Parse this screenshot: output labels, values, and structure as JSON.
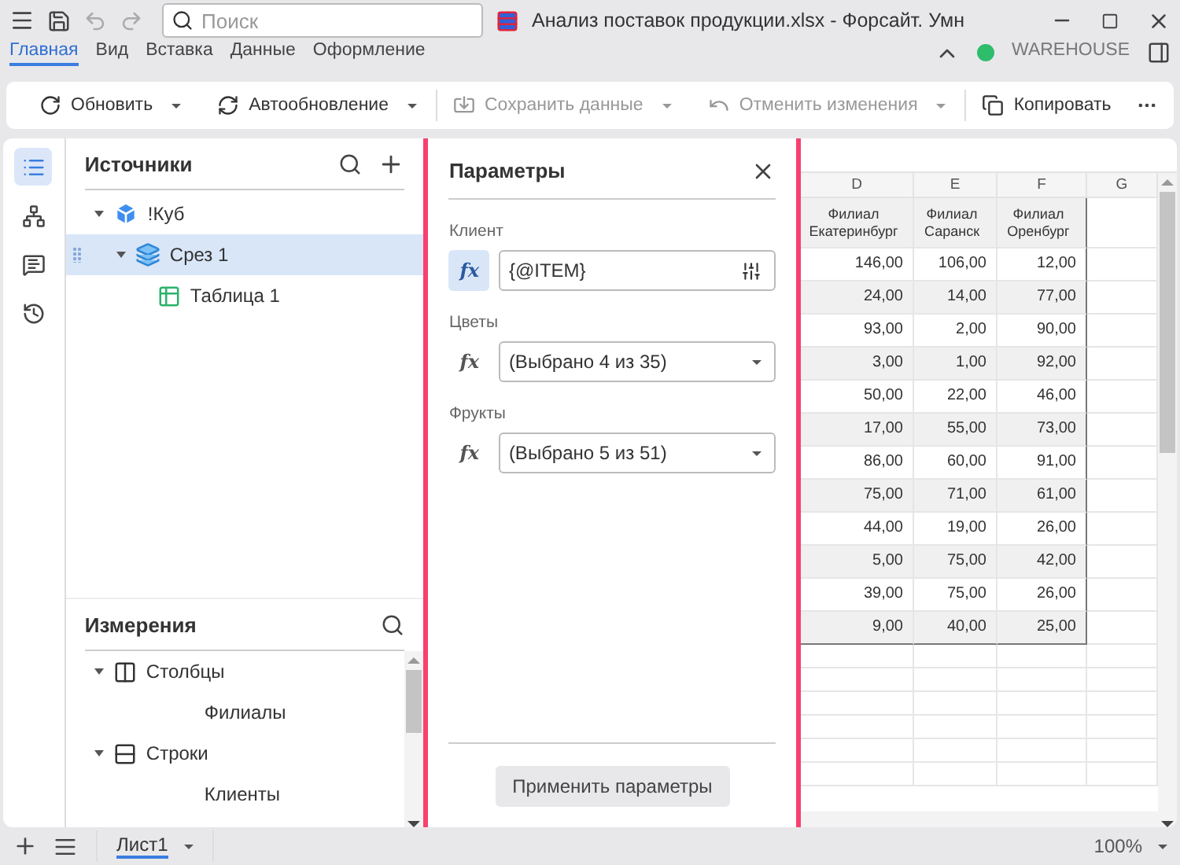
{
  "window": {
    "title": "Анализ поставок продукции.xlsx - Форсайт. Умн",
    "search": {
      "placeholder": "Поиск"
    }
  },
  "tabs": [
    {
      "label": "Главная",
      "selected": true
    },
    {
      "label": "Вид",
      "selected": false
    },
    {
      "label": "Вставка",
      "selected": false
    },
    {
      "label": "Данные",
      "selected": false
    },
    {
      "label": "Оформление",
      "selected": false
    }
  ],
  "connection": {
    "label": "WAREHOUSE",
    "color": "#2ebd6b"
  },
  "toolbar": [
    {
      "kind": "refresh",
      "label": "Обновить",
      "disabled": false,
      "dropdown": true,
      "separator": false
    },
    {
      "kind": "auto",
      "label": "Автообновление",
      "disabled": false,
      "dropdown": true,
      "separator": false
    },
    {
      "kind": "save",
      "label": "Сохранить данные",
      "disabled": true,
      "dropdown": true,
      "separator": true
    },
    {
      "kind": "revert",
      "label": "Отменить изменения",
      "disabled": true,
      "dropdown": true,
      "separator": false
    },
    {
      "kind": "copy",
      "label": "Копировать",
      "disabled": false,
      "dropdown": false,
      "separator": true
    }
  ],
  "sources": {
    "title": "Источники",
    "items": [
      {
        "kind": "cube",
        "label": "!Куб",
        "expanded": true,
        "selected": false,
        "children": [
          {
            "kind": "slice",
            "label": "Срез 1",
            "expanded": true,
            "selected": true,
            "children": [
              {
                "kind": "table",
                "label": "Таблица 1",
                "selected": false
              }
            ]
          }
        ]
      }
    ]
  },
  "dimensions": {
    "title": "Измерения",
    "items": [
      {
        "kind": "columns",
        "label": "Столбцы",
        "expanded": true,
        "children": [
          {
            "label": "Филиалы"
          }
        ]
      },
      {
        "kind": "rows",
        "label": "Строки",
        "expanded": true,
        "children": [
          {
            "label": "Клиенты"
          }
        ]
      }
    ]
  },
  "parameters": {
    "title": "Параметры",
    "apply": "Применить параметры",
    "items": [
      {
        "label": "Клиент",
        "kind": "input",
        "value": "{@ITEM}",
        "fx": "fx",
        "fx_selected": true
      },
      {
        "label": "Цветы",
        "kind": "select",
        "value": "(Выбрано 4 из 35)",
        "fx": "fx",
        "fx_selected": false
      },
      {
        "label": "Фрукты",
        "kind": "select",
        "value": "(Выбрано 5 из 51)",
        "fx": "fx",
        "fx_selected": false
      }
    ]
  },
  "sheet": {
    "columns": [
      "D",
      "E",
      "F",
      "G"
    ],
    "headers": [
      "Филиал Екатеринбург",
      "Филиал Саранск",
      "Филиал Оренбург"
    ],
    "rows": [
      [
        "146,00",
        "106,00",
        "12,00"
      ],
      [
        "24,00",
        "14,00",
        "77,00"
      ],
      [
        "93,00",
        "2,00",
        "90,00"
      ],
      [
        "3,00",
        "1,00",
        "92,00"
      ],
      [
        "50,00",
        "22,00",
        "46,00"
      ],
      [
        "17,00",
        "55,00",
        "73,00"
      ],
      [
        "86,00",
        "60,00",
        "91,00"
      ],
      [
        "75,00",
        "71,00",
        "61,00"
      ],
      [
        "44,00",
        "19,00",
        "26,00"
      ],
      [
        "5,00",
        "75,00",
        "42,00"
      ],
      [
        "39,00",
        "75,00",
        "26,00"
      ],
      [
        "9,00",
        "40,00",
        "25,00"
      ]
    ]
  },
  "status": {
    "sheets": [
      {
        "label": "Лист1",
        "selected": true
      }
    ],
    "zoom": "100%"
  }
}
